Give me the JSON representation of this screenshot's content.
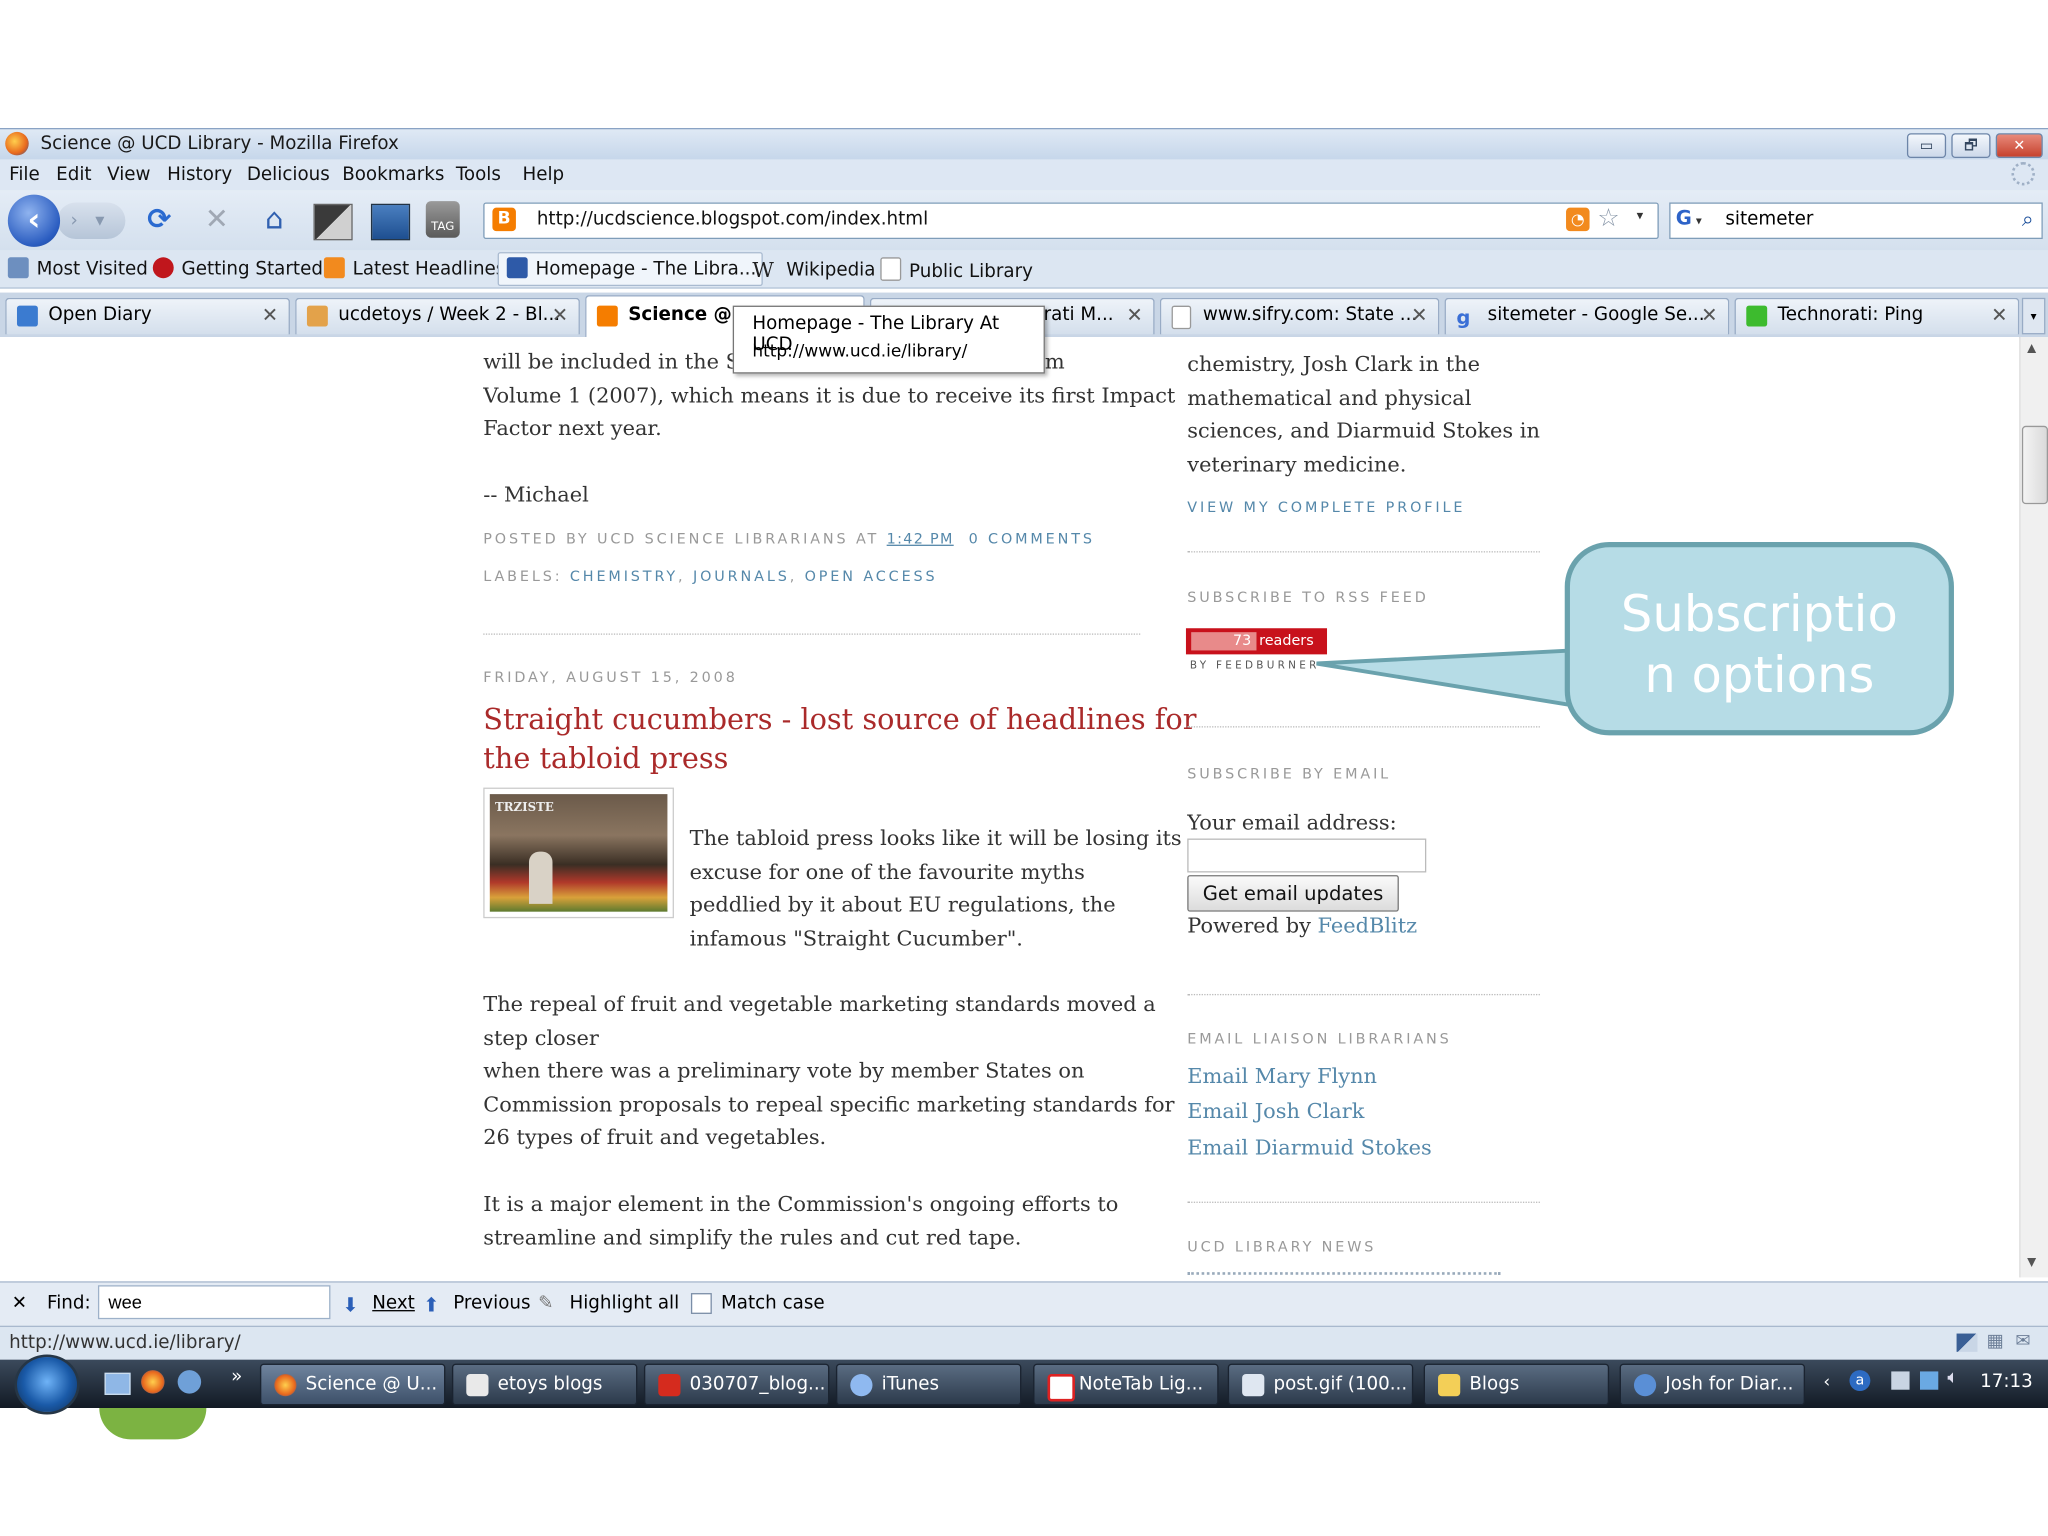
{
  "window": {
    "title": "Science @ UCD Library - Mozilla Firefox",
    "buttons": [
      "▭",
      "🗗",
      "✕"
    ]
  },
  "menu": [
    "File",
    "Edit",
    "View",
    "History",
    "Delicious",
    "Bookmarks",
    "Tools",
    "Help"
  ],
  "nav": {
    "url": "http://ucdscience.blogspot.com/index.html",
    "search_engine": "G",
    "search_value": "sitemeter",
    "tag_label": "TAG"
  },
  "bookmarks": [
    "Most Visited",
    "Getting Started",
    "Latest Headlines",
    "Homepage - The Libra...",
    "Wikipedia",
    "Public Library"
  ],
  "tabs": [
    {
      "label": "Open Diary"
    },
    {
      "label": "ucdetoys / Week 2 - Bl..."
    },
    {
      "label": "Science @ U"
    },
    {
      "label": "rati M..."
    },
    {
      "label": "www.sifry.com: State ..."
    },
    {
      "label": "sitemeter - Google Se..."
    },
    {
      "label": "Technorati: Ping"
    }
  ],
  "tooltip": {
    "title": "Homepage - The Library At UCD",
    "url": "http://www.ucd.ie/library/"
  },
  "post1": {
    "line1a": "will be included in the Sci",
    "line1b": "m",
    "line2": "Volume 1 (2007), which means it is due to receive its first Impact",
    "line3": "Factor next year.",
    "signoff": "-- Michael",
    "posted_by": "POSTED BY UCD SCIENCE LIBRARIANS AT",
    "time": "1:42 PM",
    "comments": "0 COMMENTS",
    "labels_prefix": "LABELS:",
    "labels": [
      "CHEMISTRY",
      "JOURNALS",
      "OPEN ACCESS"
    ]
  },
  "post2": {
    "date": "FRIDAY, AUGUST 15, 2008",
    "title_line1": "Straight cucumbers - lost source of headlines for",
    "title_line2": "the tabloid press",
    "image_sign": "TRZISTE",
    "intro": [
      "The tabloid press looks like it will be losing its",
      "excuse for one of the favourite myths",
      "peddlied by it about EU regulations, the",
      "infamous \"Straight Cucumber\"."
    ],
    "para2": [
      "The repeal of fruit and vegetable marketing standards moved a",
      "step closer",
      "when there was a preliminary vote by member States on",
      "Commission proposals to repeal specific marketing standards for",
      "26 types of fruit and vegetables."
    ],
    "para3": [
      "It is a major element in the Commission's ongoing efforts to",
      "streamline and simplify the rules and cut red tape."
    ]
  },
  "sidebar": {
    "profile_lines": [
      "chemistry, Josh Clark in the",
      "mathematical and physical",
      "sciences, and Diarmuid Stokes in",
      "veterinary medicine."
    ],
    "view_profile": "VIEW MY COMPLETE PROFILE",
    "rss_heading": "SUBSCRIBE TO RSS FEED",
    "feed_count": "73",
    "feed_readers": "readers",
    "feed_by": "BY FEEDBURNER",
    "email_heading": "SUBSCRIBE BY EMAIL",
    "email_label": "Your email address:",
    "email_button": "Get email updates",
    "powered_by": "Powered by",
    "powered_link": "FeedBlitz",
    "liaison_heading": "EMAIL LIAISON LIBRARIANS",
    "liaison_links": [
      "Email Mary Flynn",
      "Email Josh Clark",
      "Email Diarmuid Stokes"
    ],
    "news_heading": "UCD LIBRARY NEWS"
  },
  "callout": {
    "line1": "Subscriptio",
    "line2": "n options"
  },
  "findbar": {
    "close": "✕",
    "label": "Find:",
    "value": "wee",
    "next": "Next",
    "previous": "Previous",
    "highlight": "Highlight all",
    "match_case": "Match case"
  },
  "status": {
    "text": "http://www.ucd.ie/library/"
  },
  "taskbar": {
    "tasks": [
      "Science @ U...",
      "etoys blogs",
      "030707_blog...",
      "iTunes",
      "NoteTab Lig...",
      "post.gif (100...",
      "Blogs",
      "Josh for Diar..."
    ],
    "overflow": "»",
    "clock": "17:13"
  },
  "colors": {
    "link": "#5588aa",
    "post_title": "#aa2a2a",
    "callout_fill": "#b6dce6",
    "callout_border": "#6aa2ad",
    "feed_badge": "#c8111b"
  }
}
